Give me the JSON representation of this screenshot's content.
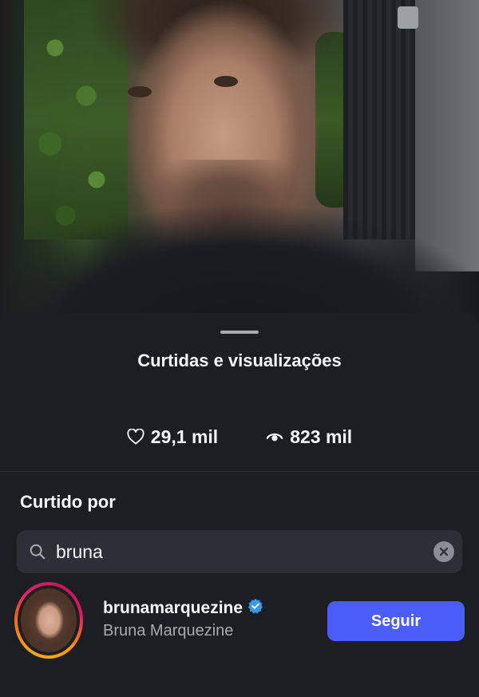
{
  "sheet": {
    "title": "Curtidas e visualizações",
    "likes": "29,1 mil",
    "views": "823 mil",
    "section_title": "Curtido por"
  },
  "search": {
    "value": "bruna",
    "icon": "search-icon",
    "clear_icon": "clear-icon"
  },
  "results": [
    {
      "username": "brunamarquezine",
      "full_name": "Bruna Marquezine",
      "verified": true,
      "follow_label": "Seguir"
    }
  ],
  "colors": {
    "accent": "#4a5df9",
    "verified": "#3897f0",
    "sheet_bg": "#1c1e22",
    "search_bg": "#2c2f35"
  }
}
